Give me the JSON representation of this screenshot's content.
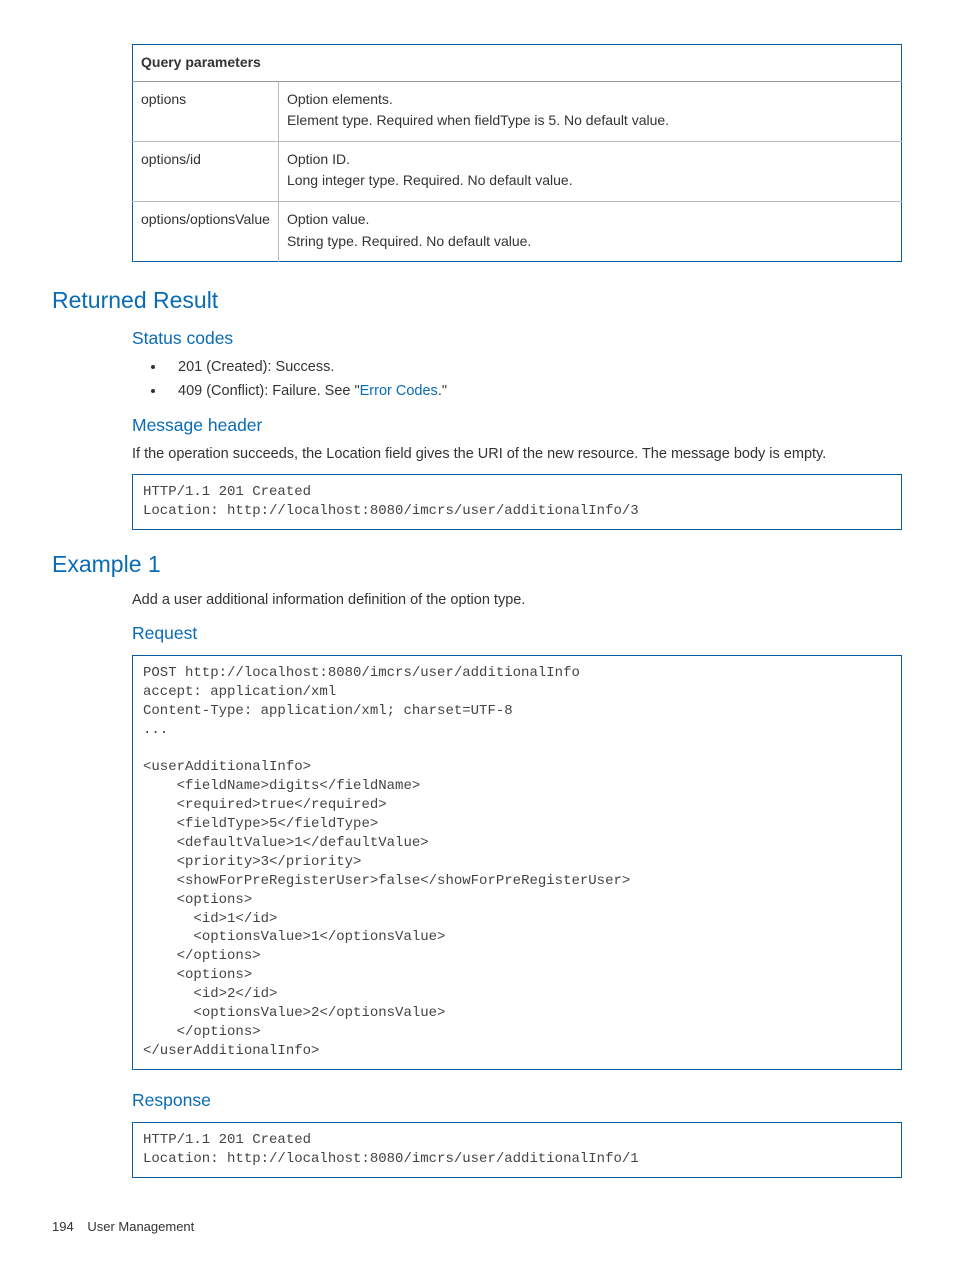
{
  "table": {
    "header": "Query parameters",
    "rows": [
      {
        "name": "options",
        "line1": "Option elements.",
        "line2": "Element type. Required when fieldType is 5. No default value."
      },
      {
        "name": "options/id",
        "line1": "Option ID.",
        "line2": "Long integer type. Required. No default value."
      },
      {
        "name": "options/optionsValue",
        "line1": "Option value.",
        "line2": "String type. Required. No default value."
      }
    ]
  },
  "returned_result": {
    "heading": "Returned Result",
    "status_codes": {
      "heading": "Status codes",
      "item1": "201 (Created): Success.",
      "item2_prefix": "409 (Conflict): Failure. See \"",
      "item2_link": "Error Codes",
      "item2_suffix": ".\""
    },
    "message_header": {
      "heading": "Message header",
      "body": "If the operation succeeds, the Location field gives the URI of the new resource. The message body is empty.",
      "code": "HTTP/1.1 201 Created\nLocation: http://localhost:8080/imcrs/user/additionalInfo/3"
    }
  },
  "example": {
    "heading": "Example 1",
    "intro": "Add a user additional information definition of the option type.",
    "request": {
      "heading": "Request",
      "code": "POST http://localhost:8080/imcrs/user/additionalInfo\naccept: application/xml\nContent-Type: application/xml; charset=UTF-8\n...\n\n<userAdditionalInfo>\n    <fieldName>digits</fieldName>\n    <required>true</required>\n    <fieldType>5</fieldType>\n    <defaultValue>1</defaultValue>\n    <priority>3</priority>\n    <showForPreRegisterUser>false</showForPreRegisterUser>\n    <options>\n      <id>1</id>\n      <optionsValue>1</optionsValue>\n    </options>\n    <options>\n      <id>2</id>\n      <optionsValue>2</optionsValue>\n    </options>\n</userAdditionalInfo>"
    },
    "response": {
      "heading": "Response",
      "code": "HTTP/1.1 201 Created\nLocation: http://localhost:8080/imcrs/user/additionalInfo/1"
    }
  },
  "footer": {
    "page_number": "194",
    "section": "User Management"
  }
}
